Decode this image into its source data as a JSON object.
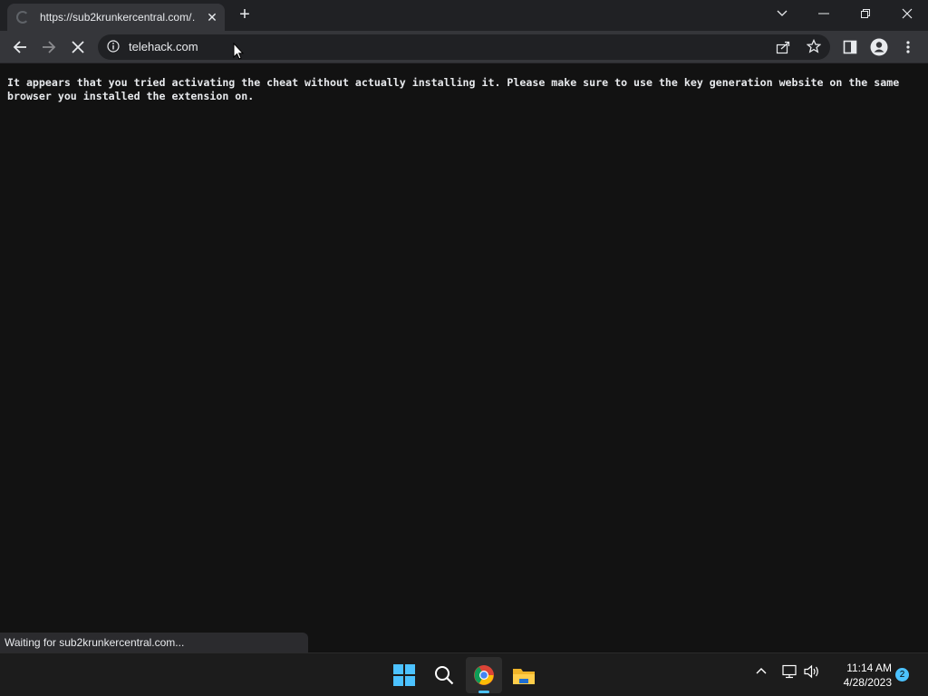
{
  "browser": {
    "tab": {
      "title": "https://sub2krunkercentral.com/…",
      "close_icon": "close-icon"
    },
    "address_bar": {
      "url": "telehack.com"
    },
    "status_text": "Waiting for sub2krunkercentral.com..."
  },
  "page": {
    "message": "It appears that you tried activating the cheat without actually installing it. Please make sure to use the key generation website on the same browser you installed the extension on."
  },
  "taskbar": {
    "time": "11:14 AM",
    "date": "4/28/2023",
    "notification_count": "2"
  },
  "colors": {
    "background": "#121212",
    "chrome_dark": "#202124",
    "chrome_toolbar": "#35363a",
    "accent": "#4cc2ff"
  }
}
